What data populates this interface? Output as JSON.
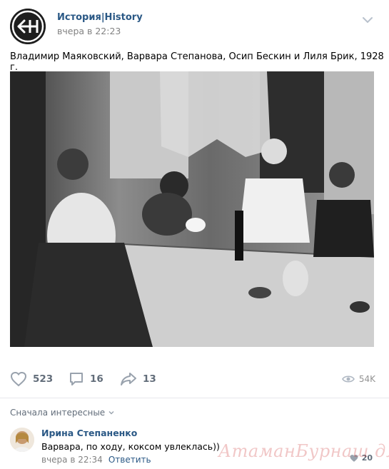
{
  "post": {
    "group_name": "История|History",
    "time": "вчера в 22:23",
    "text": "Владимир Маяковский, Варвара Степанова, Осип Бескин и Лиля Брик, 1928 г.",
    "image_alt": "photo"
  },
  "actions": {
    "likes": "523",
    "comments": "16",
    "shares": "13",
    "views": "54K"
  },
  "comments_section": {
    "sort_label": "Сначала интересные",
    "items": [
      {
        "author": "Ирина Степаненко",
        "text": "Варвара, по ходу, коксом увлеклась))",
        "time": "вчера в 22:34",
        "reply_label": "Ответить",
        "likes": "20"
      }
    ]
  },
  "watermark": "АтаманБурнаш для ЯП",
  "icons": {
    "like": "heart-icon",
    "comment": "comment-icon",
    "share": "share-arrow-icon",
    "views": "eye-icon",
    "more": "chevron-down-icon"
  },
  "colors": {
    "link": "#2a5885",
    "muted": "#828282",
    "action": "#626d7a"
  }
}
